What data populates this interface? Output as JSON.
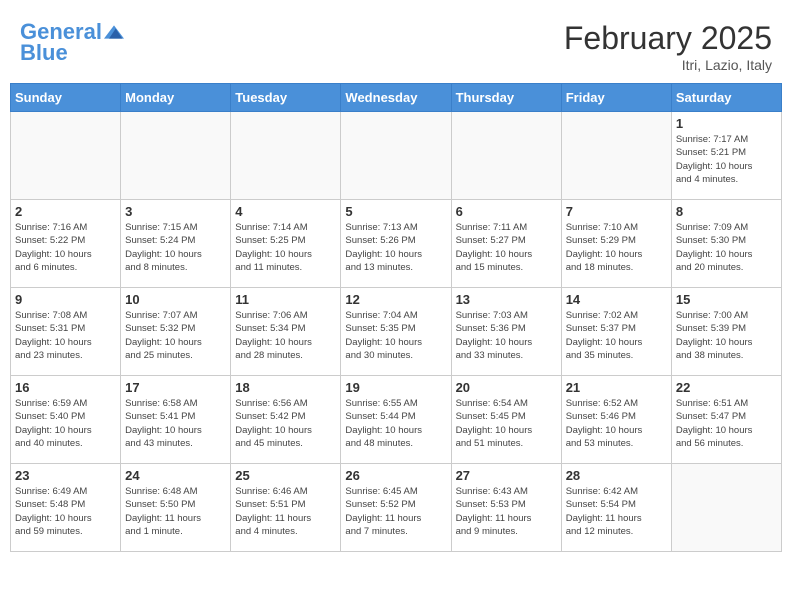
{
  "header": {
    "logo_line1": "General",
    "logo_line2": "Blue",
    "month": "February 2025",
    "location": "Itri, Lazio, Italy"
  },
  "weekdays": [
    "Sunday",
    "Monday",
    "Tuesday",
    "Wednesday",
    "Thursday",
    "Friday",
    "Saturday"
  ],
  "weeks": [
    [
      {
        "day": "",
        "info": ""
      },
      {
        "day": "",
        "info": ""
      },
      {
        "day": "",
        "info": ""
      },
      {
        "day": "",
        "info": ""
      },
      {
        "day": "",
        "info": ""
      },
      {
        "day": "",
        "info": ""
      },
      {
        "day": "1",
        "info": "Sunrise: 7:17 AM\nSunset: 5:21 PM\nDaylight: 10 hours\nand 4 minutes."
      }
    ],
    [
      {
        "day": "2",
        "info": "Sunrise: 7:16 AM\nSunset: 5:22 PM\nDaylight: 10 hours\nand 6 minutes."
      },
      {
        "day": "3",
        "info": "Sunrise: 7:15 AM\nSunset: 5:24 PM\nDaylight: 10 hours\nand 8 minutes."
      },
      {
        "day": "4",
        "info": "Sunrise: 7:14 AM\nSunset: 5:25 PM\nDaylight: 10 hours\nand 11 minutes."
      },
      {
        "day": "5",
        "info": "Sunrise: 7:13 AM\nSunset: 5:26 PM\nDaylight: 10 hours\nand 13 minutes."
      },
      {
        "day": "6",
        "info": "Sunrise: 7:11 AM\nSunset: 5:27 PM\nDaylight: 10 hours\nand 15 minutes."
      },
      {
        "day": "7",
        "info": "Sunrise: 7:10 AM\nSunset: 5:29 PM\nDaylight: 10 hours\nand 18 minutes."
      },
      {
        "day": "8",
        "info": "Sunrise: 7:09 AM\nSunset: 5:30 PM\nDaylight: 10 hours\nand 20 minutes."
      }
    ],
    [
      {
        "day": "9",
        "info": "Sunrise: 7:08 AM\nSunset: 5:31 PM\nDaylight: 10 hours\nand 23 minutes."
      },
      {
        "day": "10",
        "info": "Sunrise: 7:07 AM\nSunset: 5:32 PM\nDaylight: 10 hours\nand 25 minutes."
      },
      {
        "day": "11",
        "info": "Sunrise: 7:06 AM\nSunset: 5:34 PM\nDaylight: 10 hours\nand 28 minutes."
      },
      {
        "day": "12",
        "info": "Sunrise: 7:04 AM\nSunset: 5:35 PM\nDaylight: 10 hours\nand 30 minutes."
      },
      {
        "day": "13",
        "info": "Sunrise: 7:03 AM\nSunset: 5:36 PM\nDaylight: 10 hours\nand 33 minutes."
      },
      {
        "day": "14",
        "info": "Sunrise: 7:02 AM\nSunset: 5:37 PM\nDaylight: 10 hours\nand 35 minutes."
      },
      {
        "day": "15",
        "info": "Sunrise: 7:00 AM\nSunset: 5:39 PM\nDaylight: 10 hours\nand 38 minutes."
      }
    ],
    [
      {
        "day": "16",
        "info": "Sunrise: 6:59 AM\nSunset: 5:40 PM\nDaylight: 10 hours\nand 40 minutes."
      },
      {
        "day": "17",
        "info": "Sunrise: 6:58 AM\nSunset: 5:41 PM\nDaylight: 10 hours\nand 43 minutes."
      },
      {
        "day": "18",
        "info": "Sunrise: 6:56 AM\nSunset: 5:42 PM\nDaylight: 10 hours\nand 45 minutes."
      },
      {
        "day": "19",
        "info": "Sunrise: 6:55 AM\nSunset: 5:44 PM\nDaylight: 10 hours\nand 48 minutes."
      },
      {
        "day": "20",
        "info": "Sunrise: 6:54 AM\nSunset: 5:45 PM\nDaylight: 10 hours\nand 51 minutes."
      },
      {
        "day": "21",
        "info": "Sunrise: 6:52 AM\nSunset: 5:46 PM\nDaylight: 10 hours\nand 53 minutes."
      },
      {
        "day": "22",
        "info": "Sunrise: 6:51 AM\nSunset: 5:47 PM\nDaylight: 10 hours\nand 56 minutes."
      }
    ],
    [
      {
        "day": "23",
        "info": "Sunrise: 6:49 AM\nSunset: 5:48 PM\nDaylight: 10 hours\nand 59 minutes."
      },
      {
        "day": "24",
        "info": "Sunrise: 6:48 AM\nSunset: 5:50 PM\nDaylight: 11 hours\nand 1 minute."
      },
      {
        "day": "25",
        "info": "Sunrise: 6:46 AM\nSunset: 5:51 PM\nDaylight: 11 hours\nand 4 minutes."
      },
      {
        "day": "26",
        "info": "Sunrise: 6:45 AM\nSunset: 5:52 PM\nDaylight: 11 hours\nand 7 minutes."
      },
      {
        "day": "27",
        "info": "Sunrise: 6:43 AM\nSunset: 5:53 PM\nDaylight: 11 hours\nand 9 minutes."
      },
      {
        "day": "28",
        "info": "Sunrise: 6:42 AM\nSunset: 5:54 PM\nDaylight: 11 hours\nand 12 minutes."
      },
      {
        "day": "",
        "info": ""
      }
    ]
  ]
}
